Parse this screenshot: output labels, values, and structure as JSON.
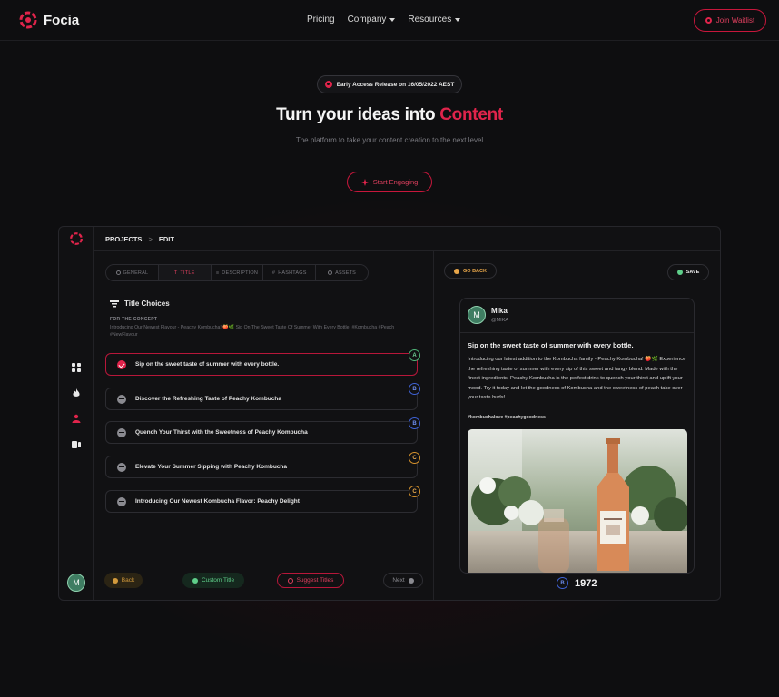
{
  "nav": {
    "brand": "Focia",
    "links": [
      {
        "label": "Pricing",
        "has_dropdown": false
      },
      {
        "label": "Company",
        "has_dropdown": true
      },
      {
        "label": "Resources",
        "has_dropdown": true
      }
    ],
    "cta_label": "Join Waitlist"
  },
  "hero": {
    "badge": "Early Access Release on 16/05/2022 AEST",
    "title_main": "Turn your ideas into ",
    "title_accent": "Content",
    "subtitle": "The platform to take your content creation to the next level",
    "cta_label": "Start Engaging"
  },
  "app": {
    "breadcrumb": [
      "PROJECTS",
      "EDIT"
    ],
    "breadcrumb_separator": ">",
    "sidebar_icons": [
      "grid-icon",
      "flame-icon",
      "user-icon",
      "cards-icon"
    ],
    "avatar_initial": "M",
    "tabs": [
      {
        "label": "GENERAL",
        "active": false
      },
      {
        "label": "TITLE",
        "active": true
      },
      {
        "label": "DESCRIPTION",
        "active": false
      },
      {
        "label": "HASHTAGS",
        "active": false
      },
      {
        "label": "ASSETS",
        "active": false
      }
    ],
    "section_title": "Title Choices",
    "concept_label": "FOR THE CONCEPT",
    "concept_text": "Introducing Our Newest Flavour - Peachy Kombucha! 🍑🌿 Sip On The Sweet Taste Of Summer With Every Bottle. #Kombucha #Peach #NewFlavour",
    "choices": [
      {
        "text": "Sip on the sweet taste of summer with every bottle.",
        "grade": "A",
        "selected": true
      },
      {
        "text": "Discover the Refreshing Taste of Peachy Kombucha",
        "grade": "B",
        "selected": false
      },
      {
        "text": "Quench Your Thirst with the Sweetness of Peachy Kombucha",
        "grade": "B",
        "selected": false
      },
      {
        "text": "Elevate Your Summer Sipping with Peachy Kombucha",
        "grade": "C",
        "selected": false
      },
      {
        "text": "Introducing Our Newest Kombucha Flavor: Peachy Delight",
        "grade": "C",
        "selected": false
      }
    ],
    "buttons": {
      "back": "Back",
      "custom": "Custom Title",
      "suggest": "Suggest Titles",
      "next": "Next"
    },
    "preview": {
      "go_back": "GO BACK",
      "save": "SAVE",
      "user_name": "Mika",
      "user_handle": "@MIKA",
      "avatar_initial": "M",
      "post_title": "Sip on the sweet taste of summer with every bottle.",
      "post_body": "Introducing our latest addition to the Kombucha family - Peachy Kombucha! 🍑🌿 Experience the refreshing taste of summer with every sip of this sweet and tangy blend. Made with the finest ingredients, Peachy Kombucha is the perfect drink to quench your thirst and uplift your mood. Try it today and let the goodness of Kombucha and the sweetness of peach take over your taste buds!",
      "hashtags": "#kombuchalove #peachygoodness",
      "score_grade": "B",
      "score_value": "1972"
    }
  },
  "colors": {
    "accent": "#e0244b",
    "grade_a": "#4fb377",
    "grade_b": "#3f62d6",
    "grade_c": "#d6922c",
    "background": "#0e0e10"
  }
}
